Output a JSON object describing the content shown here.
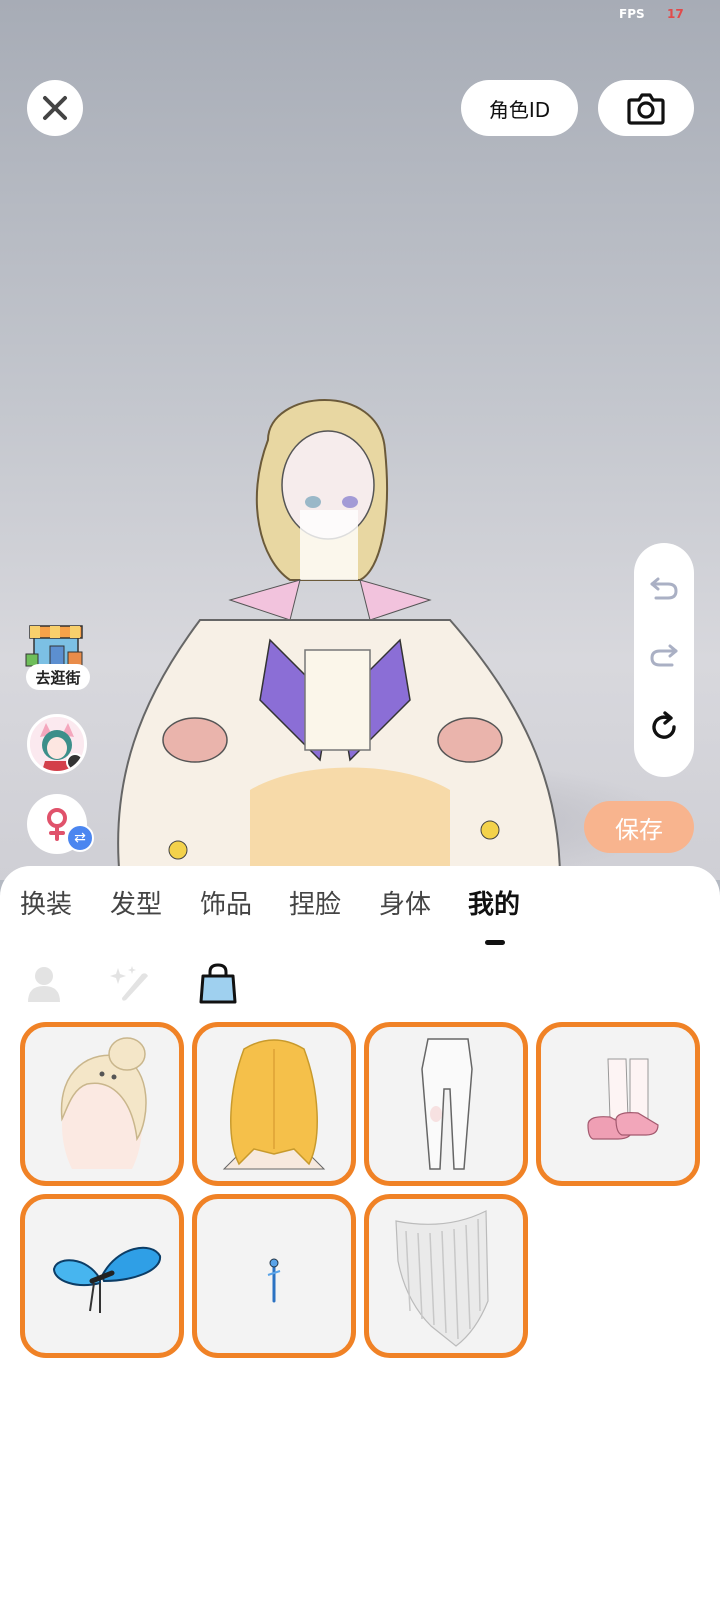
{
  "status": {
    "fps_label": "FPS",
    "fps_value": "17"
  },
  "top_bar": {
    "role_id_label": "角色ID"
  },
  "side": {
    "shop_label": "去逛街"
  },
  "save_label": "保存",
  "tabs": [
    {
      "label": "换装"
    },
    {
      "label": "发型"
    },
    {
      "label": "饰品"
    },
    {
      "label": "捏脸"
    },
    {
      "label": "身体"
    },
    {
      "label": "我的",
      "active": true
    }
  ],
  "sub_filters": [
    "person-icon",
    "sparkle-brush-icon",
    "bag-icon"
  ],
  "selected_accent_color": "#f08226",
  "save_button_color": "#f8b48e",
  "items": [
    {
      "icon": "braided-hair-icon"
    },
    {
      "icon": "golden-hair-icon"
    },
    {
      "icon": "white-tights-icon"
    },
    {
      "icon": "pink-shoes-icon"
    },
    {
      "icon": "butterfly-icon"
    },
    {
      "icon": "hairpin-icon"
    },
    {
      "icon": "veil-icon"
    }
  ]
}
